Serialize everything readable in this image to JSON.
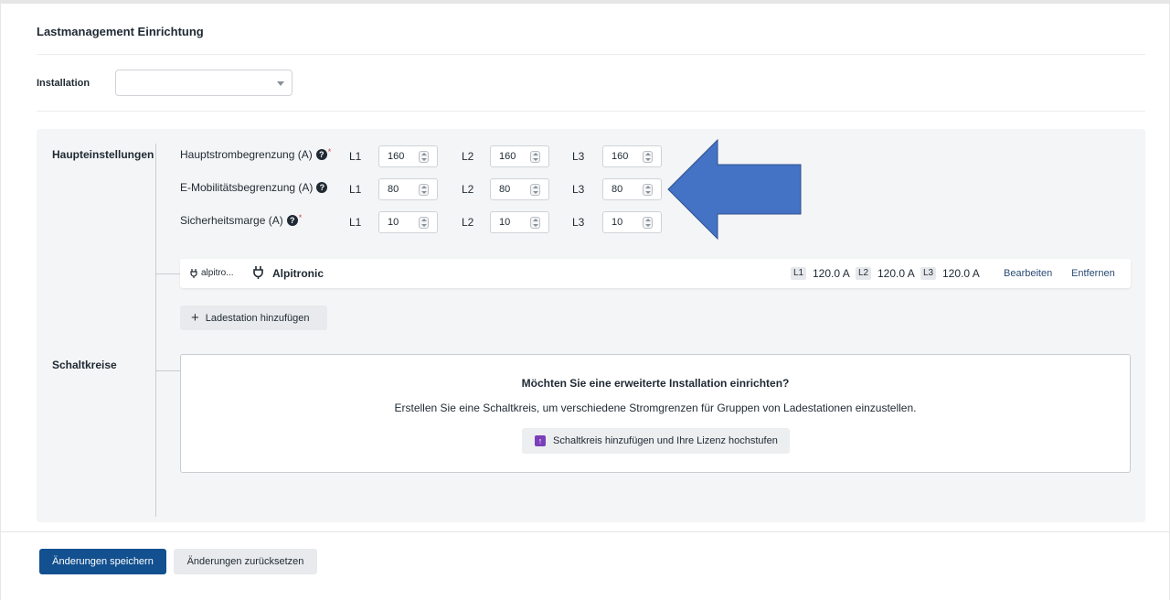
{
  "card": {
    "title": "Lastmanagement Einrichtung"
  },
  "installation": {
    "label": "Installation",
    "selected": ""
  },
  "sections": {
    "main": "Haupteinstellungen",
    "circuits": "Schaltkreise"
  },
  "limits": [
    {
      "label": "Hauptstrombegrenzung (A)",
      "required": true,
      "L1": "160",
      "L2": "160",
      "L3": "160"
    },
    {
      "label": "E-Mobilitätsbegrenzung (A)",
      "required": false,
      "L1": "80",
      "L2": "80",
      "L3": "80"
    },
    {
      "label": "Sicherheitsmarge (A)",
      "required": true,
      "L1": "10",
      "L2": "10",
      "L3": "10"
    }
  ],
  "phases": {
    "l1": "L1",
    "l2": "L2",
    "l3": "L3"
  },
  "help_symbol": "?",
  "required_symbol": "*",
  "station": {
    "tag": "alpitro...",
    "name": "Alpitronic",
    "l1_label": "L1",
    "l1_value": "120.0 A",
    "l2_label": "L2",
    "l2_value": "120.0 A",
    "l3_label": "L3",
    "l3_value": "120.0 A",
    "edit": "Bearbeiten",
    "remove": "Entfernen"
  },
  "add_station": {
    "icon": "+",
    "label": "Ladestation hinzufügen"
  },
  "circuit_promo": {
    "question": "Möchten Sie eine erweiterte Installation einrichten?",
    "description": "Erstellen Sie eine Schaltkreis, um verschiedene Stromgrenzen für Gruppen von Ladestationen einzustellen.",
    "button_icon": "↑",
    "button": "Schaltkreis hinzufügen und Ihre Lizenz hochstufen"
  },
  "footer": {
    "save": "Änderungen speichern",
    "reset": "Änderungen zurücksetzen"
  },
  "colors": {
    "primary": "#12508f",
    "annotation_arrow": "#4472c4",
    "upgrade_icon": "#7a3fb8"
  },
  "icons": {
    "plug": "plug-icon",
    "help": "question-circle-icon",
    "caret": "chevron-down-icon",
    "upgrade": "arrow-up-square-icon",
    "plus": "plus-icon",
    "annotation": "left-arrow-annotation"
  }
}
